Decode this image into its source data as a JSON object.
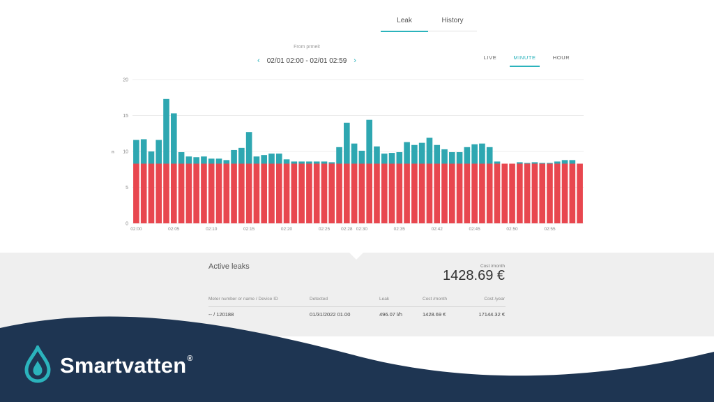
{
  "tabs": {
    "leak_label": "Leak",
    "history_label": "History",
    "active": "Leak"
  },
  "period": {
    "caption": "From prmeit",
    "range": "02/01 02:00 - 02/01 02:59"
  },
  "modes": {
    "live": "LIVE",
    "minute": "MINUTE",
    "hour": "HOUR",
    "active": "MINUTE"
  },
  "colors": {
    "leak_bar": "#e8474f",
    "flow_bar": "#2ea7b1",
    "accent": "#2bb3bc",
    "brand_dark": "#1e3552"
  },
  "chart_data": {
    "type": "bar",
    "stacked": true,
    "ylabel": "l/min",
    "ylim": [
      0,
      20
    ],
    "yticks": [
      "0",
      "5",
      "10",
      "15",
      "20"
    ],
    "xticks": [
      "02:00",
      "02:05",
      "02:10",
      "02:15",
      "02:20",
      "02:25",
      "02:28",
      "02:30",
      "02:35",
      "02:42",
      "02:45",
      "02:50",
      "02:55"
    ],
    "grid": true,
    "series": [
      {
        "values": [
          8.3,
          8.3,
          8.3,
          8.3,
          8.3,
          8.3,
          8.3,
          8.3,
          8.3,
          8.3,
          8.3,
          8.3,
          8.3,
          8.3,
          8.3,
          8.3,
          8.3,
          8.3,
          8.3,
          8.3,
          8.3,
          8.3,
          8.3,
          8.3,
          8.3,
          8.3,
          8.3,
          8.3,
          8.3,
          8.3,
          8.3,
          8.3,
          8.3,
          8.3,
          8.3,
          8.3,
          8.3,
          8.3,
          8.3,
          8.3,
          8.3,
          8.3,
          8.3,
          8.3,
          8.3,
          8.3,
          8.3,
          8.3,
          8.3,
          8.3,
          8.3,
          8.3,
          8.3,
          8.3,
          8.3,
          8.3,
          8.3,
          8.3,
          8.3,
          8.3
        ]
      },
      {
        "values": [
          11.6,
          11.7,
          10,
          11.6,
          17.3,
          15.3,
          9.9,
          9.3,
          9.2,
          9.3,
          9,
          9,
          8.8,
          10.2,
          10.5,
          12.7,
          9.3,
          9.5,
          9.7,
          9.7,
          8.9,
          8.6,
          8.6,
          8.6,
          8.6,
          8.6,
          8.5,
          10.6,
          14,
          11.1,
          10.1,
          14.4,
          10.7,
          9.7,
          9.8,
          9.9,
          11.3,
          10.9,
          11.2,
          11.9,
          10.9,
          10.3,
          9.9,
          9.9,
          10.6,
          11,
          11.1,
          10.6,
          8.6,
          8.3,
          8.3,
          8.5,
          8.4,
          8.5,
          8.4,
          8.4,
          8.6,
          8.8,
          8.8,
          8.3
        ]
      }
    ]
  },
  "panel": {
    "title": "Active leaks",
    "cost_caption": "Cost /month",
    "cost_value": "1428.69 €",
    "columns": [
      "Meter number or name / Device ID",
      "Detected",
      "Leak",
      "Cost /month",
      "Cost /year"
    ],
    "row": [
      "-- / 120188",
      "01/31/2022 01.00",
      "496.07 l/h",
      "1428.69 €",
      "17144.32 €"
    ]
  },
  "brand": {
    "name": "Smartvatten",
    "reg": "®",
    "logo_icon": "water-drop-icon"
  }
}
